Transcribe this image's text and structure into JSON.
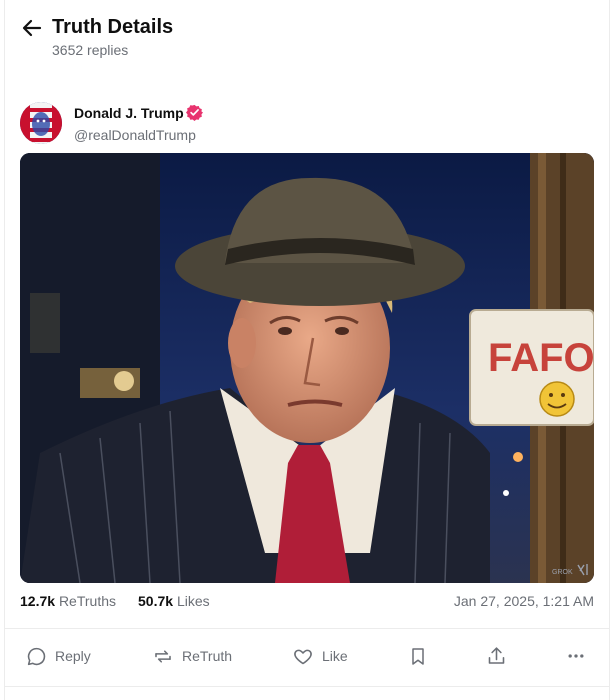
{
  "header": {
    "title": "Truth Details",
    "replies": "3652 replies"
  },
  "author": {
    "name": "Donald J. Trump",
    "handle": "@realDonaldTrump",
    "verified": true
  },
  "post_image": {
    "sign_text": "FAFO",
    "watermark": "GROK"
  },
  "stats": {
    "retruths_count": "12.7k",
    "retruths_label": "ReTruths",
    "likes_count": "50.7k",
    "likes_label": "Likes",
    "timestamp": "Jan 27, 2025, 1:21 AM"
  },
  "actions": {
    "reply": "Reply",
    "retruth": "ReTruth",
    "like": "Like"
  },
  "colors": {
    "verified_badge": "#e8336e",
    "muted_text": "#6b6f76",
    "primary_text": "#0f0f0f"
  }
}
